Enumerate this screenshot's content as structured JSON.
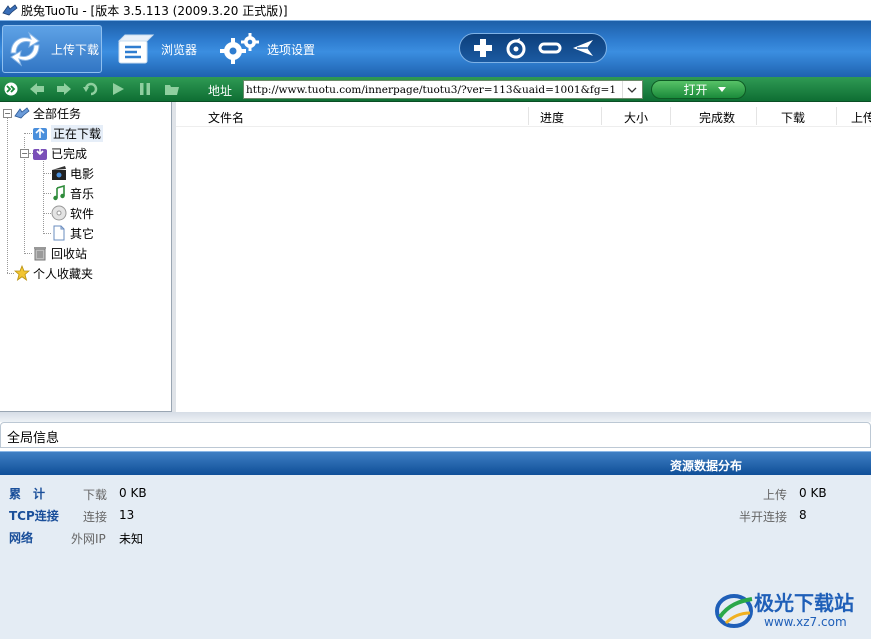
{
  "window": {
    "title": "脱兔TuoTu - [版本 3.5.113 (2009.3.20 正式版)]"
  },
  "toolbar": {
    "buttons": [
      {
        "label": "上传下载",
        "icon": "upload-download-icon",
        "active": true
      },
      {
        "label": "浏览器",
        "icon": "browser-icon",
        "active": false
      },
      {
        "label": "选项设置",
        "icon": "settings-gear-icon",
        "active": false
      }
    ],
    "quick_actions": [
      "add-icon",
      "refresh-icon",
      "minimize-icon",
      "send-icon"
    ]
  },
  "navbar": {
    "address_label": "地址",
    "address_value": "http://www.tuotu.com/innerpage/tuotu3/?ver=113&uaid=1001&fg=1",
    "open_label": "打开"
  },
  "tree": {
    "items": [
      {
        "label": "全部任务",
        "icon": "all-tasks-icon"
      },
      {
        "label": "正在下载",
        "icon": "downloading-icon",
        "selected": true
      },
      {
        "label": "已完成",
        "icon": "completed-icon"
      },
      {
        "label": "电影",
        "icon": "movie-icon"
      },
      {
        "label": "音乐",
        "icon": "music-icon"
      },
      {
        "label": "软件",
        "icon": "software-icon"
      },
      {
        "label": "其它",
        "icon": "other-icon"
      },
      {
        "label": "回收站",
        "icon": "recycle-bin-icon"
      },
      {
        "label": "个人收藏夹",
        "icon": "favorites-star-icon"
      }
    ]
  },
  "list": {
    "columns": [
      "文件名",
      "进度",
      "大小",
      "完成数",
      "下载",
      "上传"
    ]
  },
  "global": {
    "title": "全局信息",
    "band_title": "资源数据分布",
    "rows": [
      {
        "key": "累　计",
        "label": "下载",
        "value": "0 KB",
        "right_label": "上传",
        "right_value": "0 KB"
      },
      {
        "key": "TCP连接",
        "label": "连接",
        "value": "13",
        "right_label": "半开连接",
        "right_value": "8"
      },
      {
        "key": "网络",
        "label": "外网IP",
        "value": "未知"
      }
    ]
  },
  "watermark": {
    "text": "极光下载站",
    "url": "www.xz7.com"
  },
  "colors": {
    "toolbar_blue": "#2f7dd0",
    "nav_green": "#1a8a3a",
    "band_blue": "#0f4f98",
    "stats_bg": "#e4ecf4",
    "key_blue": "#1a4f9a"
  }
}
